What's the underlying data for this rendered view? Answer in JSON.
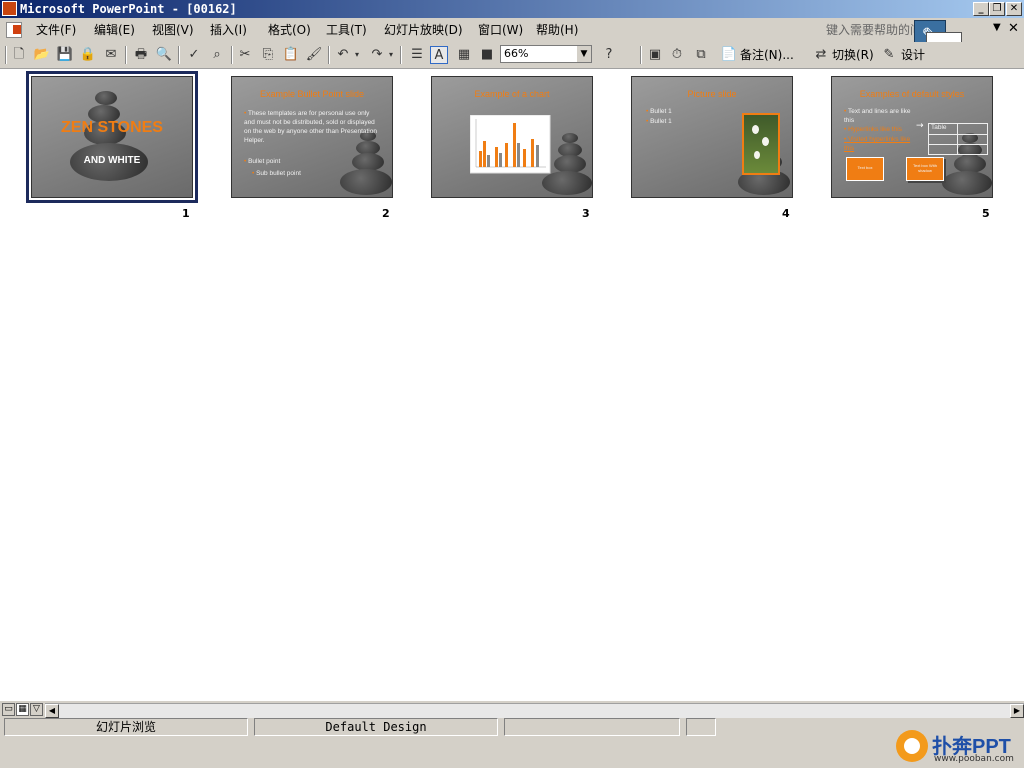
{
  "window": {
    "title": "Microsoft PowerPoint - [00162]",
    "minimize": "_",
    "restore": "❐",
    "close": "✕"
  },
  "menubar": {
    "items": [
      {
        "label": "文件(F)"
      },
      {
        "label": "编辑(E)"
      },
      {
        "label": "视图(V)"
      },
      {
        "label": "插入(I)"
      },
      {
        "label": "格式(O)"
      },
      {
        "label": "工具(T)"
      },
      {
        "label": "幻灯片放映(D)"
      },
      {
        "label": "窗口(W)"
      },
      {
        "label": "帮助(H)"
      }
    ],
    "help_prompt": "键入需要帮助的问题",
    "doc_close": "✕"
  },
  "toolbar": {
    "zoom": "66%",
    "notes_label": "备注(N)...",
    "switch_label": "切换(R)",
    "design_label": "设计"
  },
  "slides": [
    {
      "number": "1",
      "title": "ZEN STONES",
      "subtitle": "AND WHITE"
    },
    {
      "number": "2",
      "title": "Example Bullet Point slide",
      "bullets": [
        "These templates are for personal use only and must not be distributed, sold or displayed on the web by anyone other than Presentation Helper.",
        "Bullet point",
        "Sub bullet point"
      ]
    },
    {
      "number": "3",
      "title": "Example of a chart"
    },
    {
      "number": "4",
      "title": "Picture slide",
      "bullets": [
        "Bullet 1",
        "Bullet 1"
      ]
    },
    {
      "number": "5",
      "title": "Examples of default styles",
      "bullets": [
        "Text and lines are like this",
        "Hyperlinks like this",
        "Visited hyperlinks like this"
      ],
      "table_label": "Table",
      "shape_label_1": "Text box",
      "shape_label_2": "Text box With shadow"
    }
  ],
  "statusbar": {
    "view": "幻灯片浏览",
    "design": "Default Design"
  },
  "watermark": {
    "brand": "扑奔PPT",
    "url": "www.pooban.com"
  },
  "colors": {
    "accent": "#f07d13",
    "titlebar_start": "#0a246a",
    "titlebar_end": "#a6caf0",
    "chrome": "#d4d0c8",
    "selection": "#1c2a5c"
  }
}
